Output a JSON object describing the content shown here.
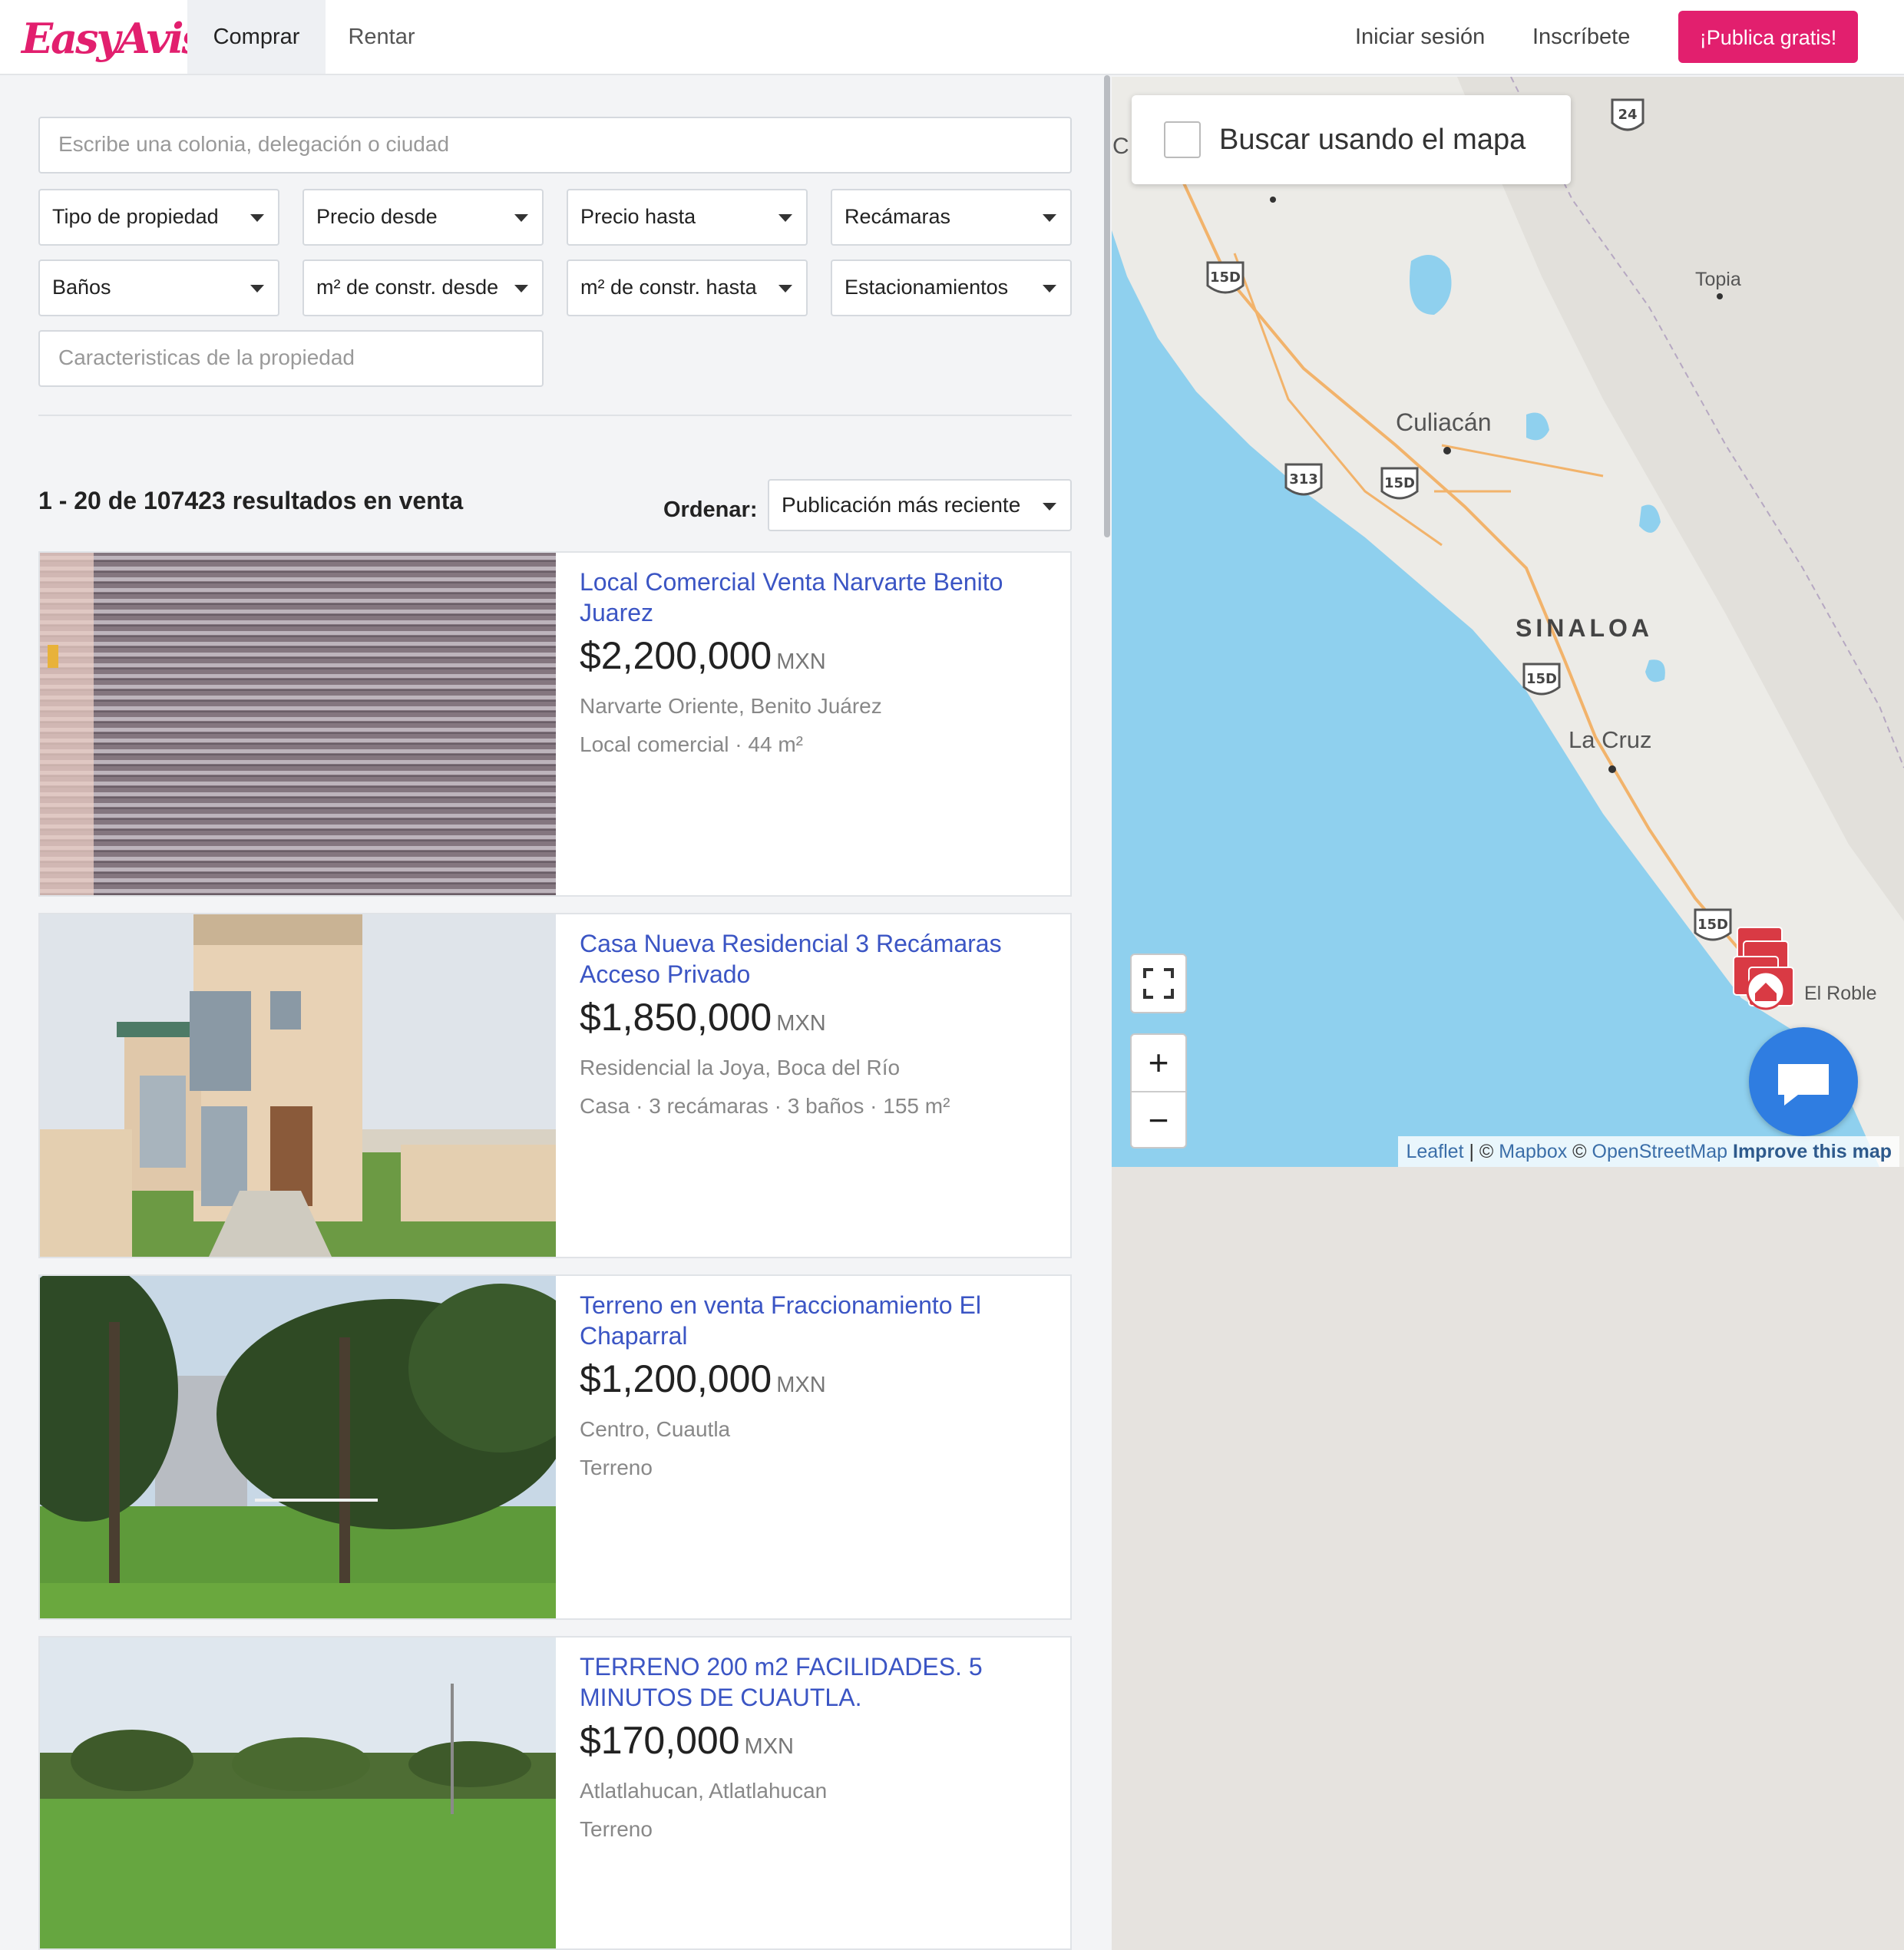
{
  "header": {
    "logo": "EasyAviso",
    "tabs": [
      {
        "label": "Comprar",
        "active": true
      },
      {
        "label": "Rentar",
        "active": false
      }
    ],
    "login": "Iniciar sesión",
    "signup": "Inscríbete",
    "publish": "¡Publica gratis!"
  },
  "filters": {
    "search_placeholder": "Escribe una colonia, delegación o ciudad",
    "selects": [
      "Tipo de propiedad",
      "Precio desde",
      "Precio hasta",
      "Recámaras",
      "Baños",
      "m² de constr. desde",
      "m² de constr. hasta",
      "Estacionamientos"
    ],
    "features_placeholder": "Caracteristicas de la propiedad"
  },
  "results": {
    "count_text": "1 - 20 de 107423 resultados en venta",
    "sort_label": "Ordenar:",
    "sort_value": "Publicación más reciente"
  },
  "listings": [
    {
      "title": "Local Comercial Venta Narvarte Benito Juarez",
      "price": "$2,200,000",
      "currency": "MXN",
      "location": "Narvarte Oriente, Benito Juárez",
      "meta": "Local comercial · 44 m²"
    },
    {
      "title": "Casa Nueva Residencial 3 Recámaras Acceso Privado",
      "price": "$1,850,000",
      "currency": "MXN",
      "location": "Residencial la Joya, Boca del Río",
      "meta": "Casa · 3 recámaras · 3 baños · 155 m²"
    },
    {
      "title": "Terreno en venta Fraccionamiento El Chaparral",
      "price": "$1,200,000",
      "currency": "MXN",
      "location": "Centro, Cuautla",
      "meta": "Terreno"
    },
    {
      "title": "TERRENO 200 m2 FACILIDADES. 5 MINUTOS DE CUAUTLA.",
      "price": "$170,000",
      "currency": "MXN",
      "location": "Atlatlahucan, Atlatlahucan",
      "meta": "Terreno"
    }
  ],
  "map": {
    "search_with_map": "Buscar usando el mapa",
    "labels": {
      "city1": "Culiacán",
      "state": "SINALOA",
      "city2": "La Cruz",
      "city3": "Topia",
      "city4": "El Roble",
      "edge": "C"
    },
    "highways": [
      "24",
      "15D",
      "313",
      "15D",
      "15D",
      "15D"
    ],
    "attribution": {
      "leaflet": "Leaflet",
      "sep1": " | © ",
      "mapbox": "Mapbox",
      "sep2": " © ",
      "osm": "OpenStreetMap",
      "improve": "Improve this map"
    },
    "zoom_in": "+",
    "zoom_out": "−"
  },
  "colors": {
    "brand": "#e21f6e",
    "link": "#3b55c4",
    "water": "#8fd0ee",
    "land": "#ecebe7"
  }
}
